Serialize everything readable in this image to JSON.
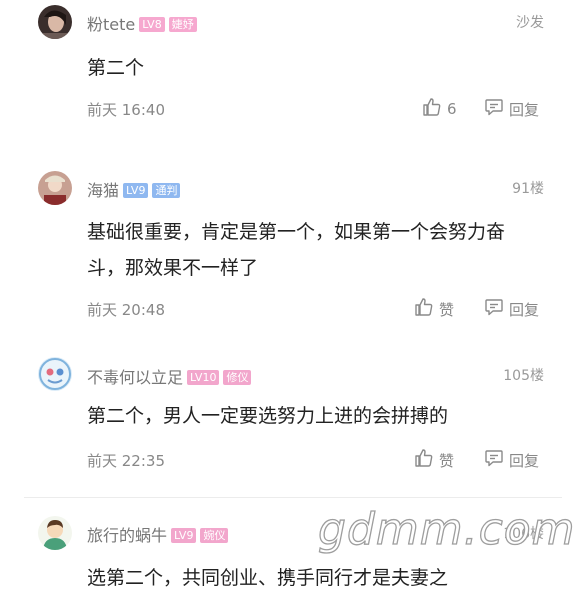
{
  "comments": [
    {
      "username": "粉tete",
      "level": "LV8",
      "title": "婕妤",
      "level_color": "#f6a8cf",
      "title_color": "#f6a8cf",
      "floor": "沙发",
      "text": "第二个",
      "time": "前天 16:40",
      "like_label": "6",
      "reply_label": "回复"
    },
    {
      "username": "海猫",
      "level": "LV9",
      "title": "通判",
      "level_color": "#8fb8f0",
      "title_color": "#8fb8f0",
      "floor": "91楼",
      "text": "基础很重要，肯定是第一个，如果第一个会努力奋斗，那效果不一样了",
      "time": "前天 20:48",
      "like_label": "赞",
      "reply_label": "回复"
    },
    {
      "username": "不毒何以立足",
      "level": "LV10",
      "title": "修仪",
      "level_color": "#f2a6cc",
      "title_color": "#f2a6cc",
      "floor": "105楼",
      "text": "第二个，男人一定要选努力上进的会拼搏的",
      "time": "前天 22:35",
      "like_label": "赞",
      "reply_label": "回复"
    },
    {
      "username": "旅行的蜗牛",
      "level": "LV9",
      "title": "婉仪",
      "level_color": "#f2a6cc",
      "title_color": "#f2a6cc",
      "floor": "106楼",
      "text": "选第二个，共同创业、携手同行才是夫妻之"
    }
  ],
  "watermark": "gdmm.com",
  "icons": {
    "like": "thumbs-up-icon",
    "reply": "reply-bubble-icon"
  }
}
